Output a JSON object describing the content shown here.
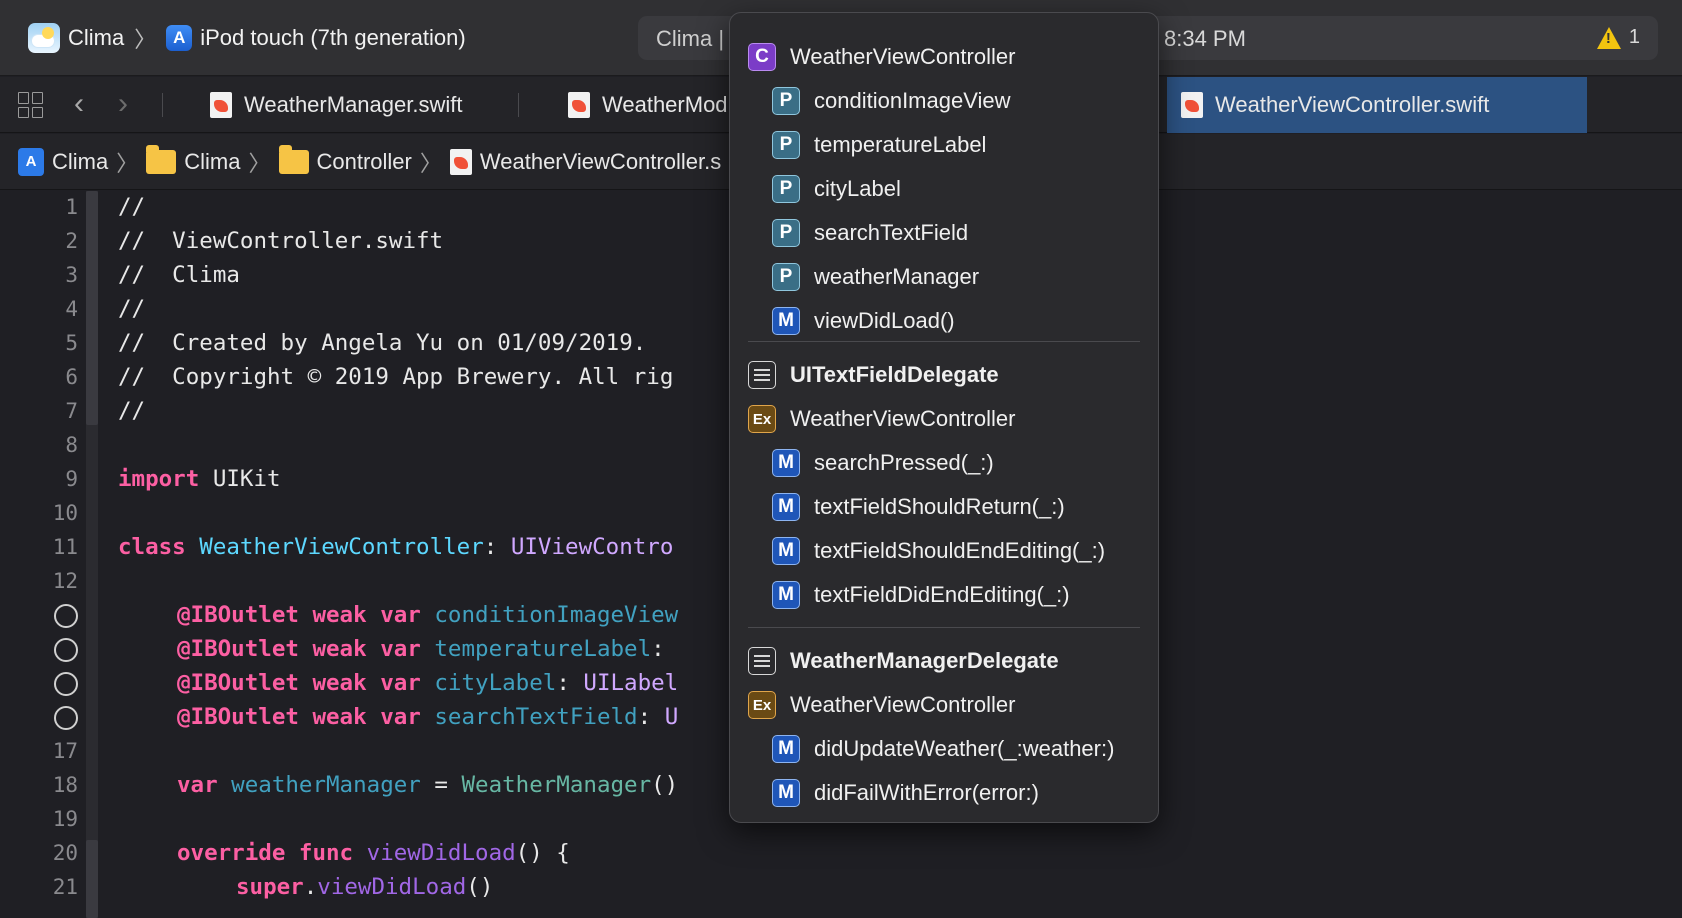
{
  "toolbar": {
    "scheme": "Clima",
    "device": "iPod touch (7th generation)",
    "status_app": "Clima |",
    "status_time": "8:34 PM",
    "warning_count": "1"
  },
  "tabs": [
    {
      "label": "WeatherManager.swift"
    },
    {
      "label": "WeatherMod"
    },
    {
      "label": "WeatherViewController.swift"
    }
  ],
  "jumpbar": {
    "project": "Clima",
    "group": "Clima",
    "folder": "Controller",
    "file": "WeatherViewController.s"
  },
  "editor": {
    "lines": [
      {
        "n": "1",
        "text": "//"
      },
      {
        "n": "2",
        "text": "//  ViewController.swift"
      },
      {
        "n": "3",
        "text": "//  Clima"
      },
      {
        "n": "4",
        "text": "//"
      },
      {
        "n": "5",
        "text": "//  Created by Angela Yu on 01/09/2019."
      },
      {
        "n": "6",
        "text": "//  Copyright © 2019 App Brewery. All rig"
      },
      {
        "n": "7",
        "text": "//"
      },
      {
        "n": "8",
        "text": ""
      },
      {
        "n": "9",
        "kw": "import",
        "rest": " UIKit"
      },
      {
        "n": "10",
        "text": ""
      },
      {
        "n": "11",
        "kw": "class",
        "type": " WeatherViewController",
        "punct": ": ",
        "sys": "UIViewContro"
      },
      {
        "n": "12",
        "text": ""
      },
      {
        "n": "",
        "outlet": true,
        "name": "conditionImageView",
        "tail": ""
      },
      {
        "n": "",
        "outlet": true,
        "name": "temperatureLabel",
        "tail": ":"
      },
      {
        "n": "",
        "outlet": true,
        "name": "cityLabel",
        "tail": ": ",
        "tailType": "UILabel"
      },
      {
        "n": "",
        "outlet": true,
        "name": "searchTextField",
        "tail": ": ",
        "tailType": "U"
      },
      {
        "n": "17",
        "text": ""
      },
      {
        "n": "18",
        "var": "var",
        "name": " weatherManager",
        "eq": " = ",
        "call": "WeatherManager",
        "end": "()"
      },
      {
        "n": "19",
        "text": ""
      },
      {
        "n": "20",
        "override": "override func",
        "fn": " viewDidLoad",
        "end": "() {"
      },
      {
        "n": "21",
        "super": "super",
        "dot": ".",
        "fn": "viewDidLoad",
        "end": "()"
      }
    ],
    "outlet_kw": "@IBOutlet",
    "weak_kw": "weak",
    "var_kw": "var"
  },
  "popover": {
    "items": [
      {
        "kind": "C",
        "label": "WeatherViewController",
        "indent": false,
        "bold": false
      },
      {
        "kind": "P",
        "label": "conditionImageView",
        "indent": true,
        "bold": false
      },
      {
        "kind": "P",
        "label": "temperatureLabel",
        "indent": true,
        "bold": false
      },
      {
        "kind": "P",
        "label": "cityLabel",
        "indent": true,
        "bold": false
      },
      {
        "kind": "P",
        "label": "searchTextField",
        "indent": true,
        "bold": false
      },
      {
        "kind": "P",
        "label": "weatherManager",
        "indent": true,
        "bold": false
      },
      {
        "kind": "M",
        "label": "viewDidLoad()",
        "indent": true,
        "bold": false
      },
      {
        "kind": "proto",
        "label": "UITextFieldDelegate",
        "indent": false,
        "bold": true
      },
      {
        "kind": "Ex",
        "label": "WeatherViewController",
        "indent": false,
        "bold": false
      },
      {
        "kind": "M",
        "label": "searchPressed(_:)",
        "indent": true,
        "bold": false
      },
      {
        "kind": "M",
        "label": "textFieldShouldReturn(_:)",
        "indent": true,
        "bold": false
      },
      {
        "kind": "M",
        "label": "textFieldShouldEndEditing(_:)",
        "indent": true,
        "bold": false
      },
      {
        "kind": "M",
        "label": "textFieldDidEndEditing(_:)",
        "indent": true,
        "bold": false
      },
      {
        "kind": "proto",
        "label": "WeatherManagerDelegate",
        "indent": false,
        "bold": true
      },
      {
        "kind": "Ex",
        "label": "WeatherViewController",
        "indent": false,
        "bold": false
      },
      {
        "kind": "M",
        "label": "didUpdateWeather(_:weather:)",
        "indent": true,
        "bold": false
      },
      {
        "kind": "M",
        "label": "didFailWithError(error:)",
        "indent": true,
        "bold": false
      }
    ]
  }
}
